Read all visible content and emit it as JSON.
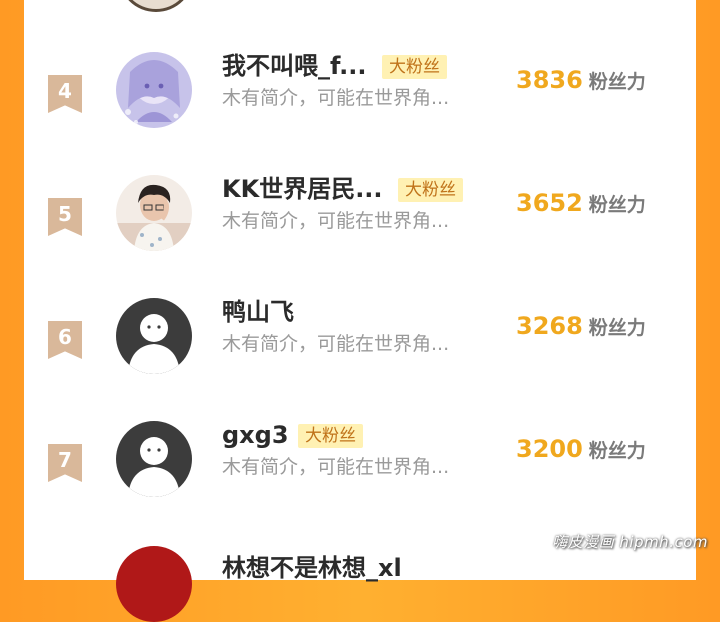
{
  "list": {
    "fans_label": "粉丝力",
    "rows": [
      {
        "rank": "4",
        "name": "我不叫喂_f...",
        "badge": "大粉丝",
        "bio": "木有简介，可能在世界角...",
        "score": "3836",
        "avatar_icon": "anime-girl-avatar"
      },
      {
        "rank": "5",
        "name": "KK世界居民...",
        "badge": "大粉丝",
        "bio": "木有简介，可能在世界角...",
        "score": "3652",
        "avatar_icon": "boy-photo-avatar"
      },
      {
        "rank": "6",
        "name": "鸭山飞",
        "badge": "",
        "bio": "木有简介，可能在世界角...",
        "score": "3268",
        "avatar_icon": "default-avatar"
      },
      {
        "rank": "7",
        "name": "gxg3",
        "badge": "大粉丝",
        "bio": "木有简介，可能在世界角...",
        "score": "3200",
        "avatar_icon": "default-avatar"
      }
    ],
    "partial_bottom_name": "林想不是林想_xl"
  },
  "watermark": "嗨皮漫画 hipmh.com",
  "colors": {
    "background_orange": "#ffa52a",
    "score": "#f0a81e",
    "badge_bg": "#fff1b3",
    "badge_text": "#c0731a",
    "rank_ribbon": "#d9b89a"
  }
}
